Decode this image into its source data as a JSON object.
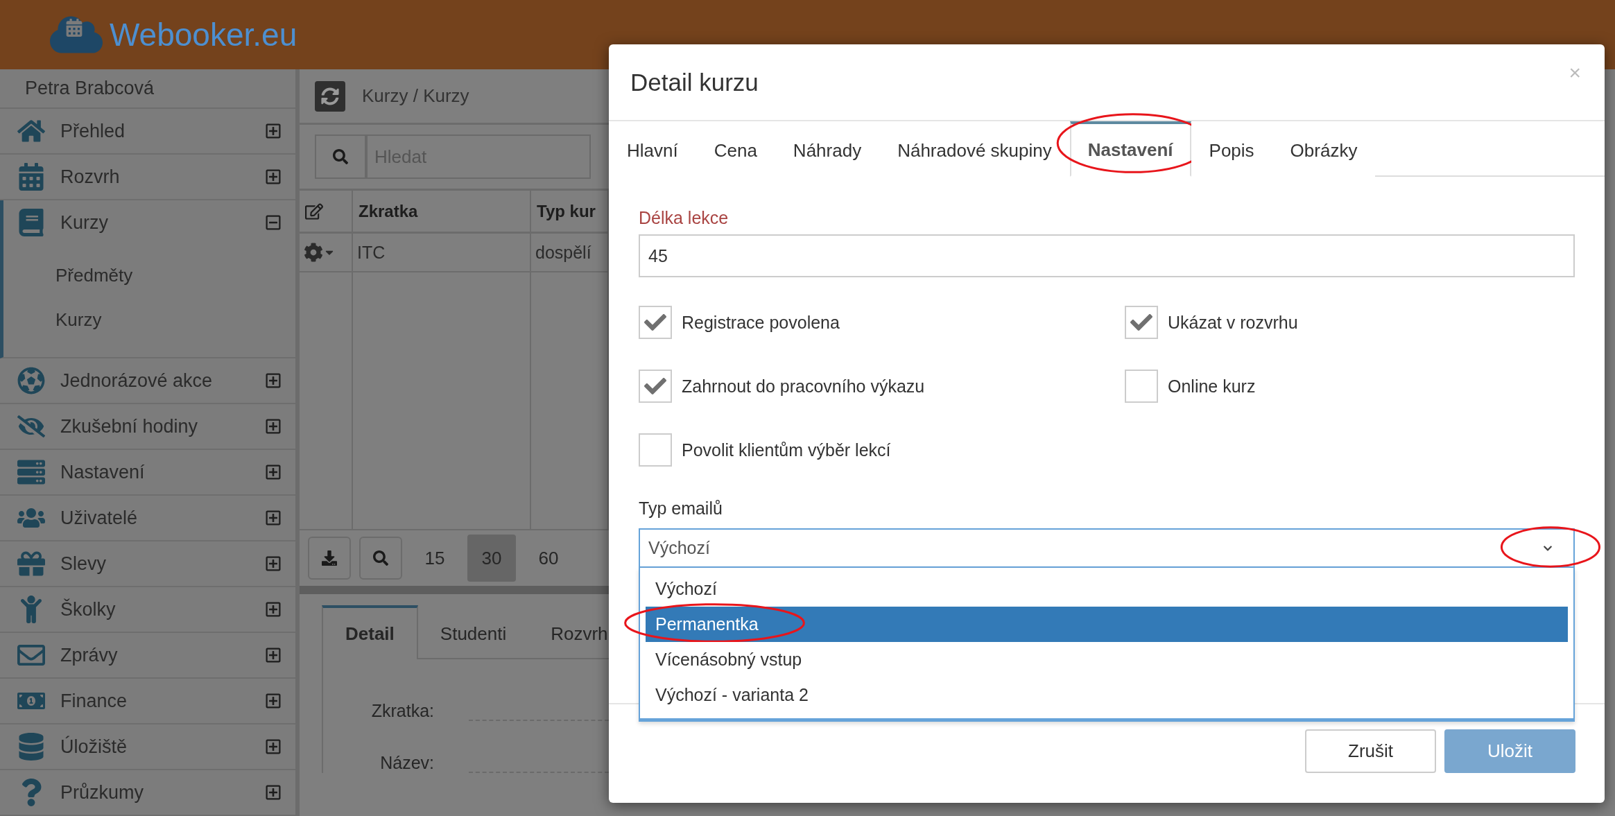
{
  "header": {
    "logo": "Webooker.eu"
  },
  "sidebar": {
    "user": "Petra Brabcová",
    "items": [
      {
        "label": "Přehled",
        "expanded": false
      },
      {
        "label": "Rozvrh",
        "expanded": false
      },
      {
        "label": "Kurzy",
        "expanded": true,
        "children": [
          {
            "label": "Předměty"
          },
          {
            "label": "Kurzy"
          }
        ]
      },
      {
        "label": "Jednorázové akce",
        "expanded": false
      },
      {
        "label": "Zkušební hodiny",
        "expanded": false
      },
      {
        "label": "Nastavení",
        "expanded": false
      },
      {
        "label": "Uživatelé",
        "expanded": false
      },
      {
        "label": "Slevy",
        "expanded": false
      },
      {
        "label": "Školky",
        "expanded": false
      },
      {
        "label": "Zprávy",
        "expanded": false
      },
      {
        "label": "Finance",
        "expanded": false
      },
      {
        "label": "Úložiště",
        "expanded": false
      },
      {
        "label": "Průzkumy",
        "expanded": false
      }
    ]
  },
  "breadcrumb": "Kurzy / Kurzy",
  "search": {
    "placeholder": "Hledat"
  },
  "table": {
    "columns": [
      "Zkratka",
      "Typ kur"
    ],
    "rows": [
      [
        "ITC",
        "dospělí"
      ]
    ]
  },
  "pager": [
    {
      "label": "15",
      "selected": false
    },
    {
      "label": "30",
      "selected": true
    },
    {
      "label": "60",
      "selected": false
    }
  ],
  "detail": {
    "tabs": [
      {
        "label": "Detail",
        "selected": true
      },
      {
        "label": "Studenti",
        "selected": false
      },
      {
        "label": "Rozvrh",
        "selected": false
      }
    ],
    "fields": [
      "Zkratka:",
      "Název:"
    ]
  },
  "modal": {
    "title": "Detail kurzu",
    "close": "×",
    "tabs": [
      {
        "label": "Hlavní",
        "selected": false
      },
      {
        "label": "Cena",
        "selected": false
      },
      {
        "label": "Náhrady",
        "selected": false
      },
      {
        "label": "Náhradové skupiny",
        "selected": false
      },
      {
        "label": "Nastavení",
        "selected": true
      },
      {
        "label": "Popis",
        "selected": false
      },
      {
        "label": "Obrázky",
        "selected": false
      }
    ],
    "length": {
      "label": "Délka lekce",
      "value": "45"
    },
    "checkboxes": [
      {
        "label": "Registrace povolena",
        "checked": true
      },
      {
        "label": "Ukázat v rozvrhu",
        "checked": true
      },
      {
        "label": "Zahrnout do pracovního výkazu",
        "checked": true
      },
      {
        "label": "Online kurz",
        "checked": false
      },
      {
        "label": "Povolit klientům výběr lekcí",
        "checked": false
      }
    ],
    "email_type": {
      "label": "Typ emailů",
      "value": "Výchozí",
      "expanded": true,
      "options": [
        {
          "label": "Výchozí",
          "highlighted": false
        },
        {
          "label": "Permanentka",
          "highlighted": true
        },
        {
          "label": "Vícenásobný vstup",
          "highlighted": false
        },
        {
          "label": "Výchozí - varianta 2",
          "highlighted": false
        }
      ]
    },
    "buttons": [
      {
        "label": "Zrušit",
        "kind": "default"
      },
      {
        "label": "Uložit",
        "kind": "primary"
      }
    ]
  }
}
